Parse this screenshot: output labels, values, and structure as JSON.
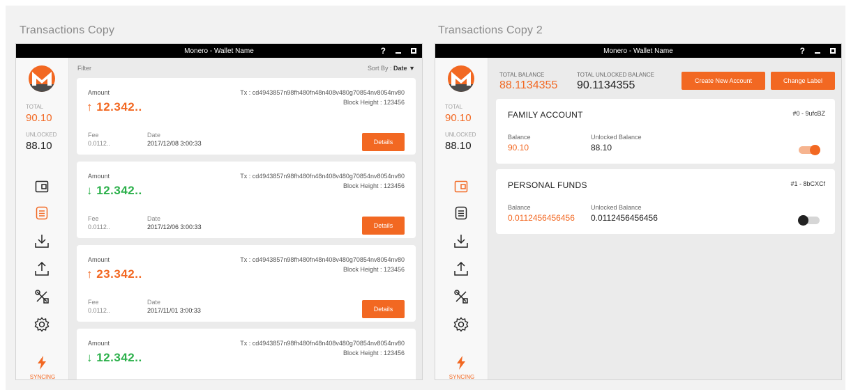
{
  "panels": [
    {
      "title": "Transactions Copy",
      "window_title": "Monero - Wallet Name",
      "help": "?",
      "sidebar": {
        "total_label": "TOTAL",
        "total_value": "90.10",
        "unlocked_label": "UNLOCKED",
        "unlocked_value": "88.10",
        "syncing": "SYNCING",
        "sync_progress": 0
      },
      "filter_label": "Filter",
      "sort_label": "Sort By :",
      "sort_value": "Date",
      "transactions": [
        {
          "amount_label": "Amount",
          "direction": "in",
          "arrow": "↑",
          "amount": "12.342..",
          "tx": "Tx : cd4943857n98fh480fn48n408v480g70854nv8054nv80",
          "block_height": "Block Height : 123456",
          "fee_label": "Fee",
          "fee": "0.0112..",
          "date_label": "Date",
          "date": "2017/12/08 3:00:33",
          "details": "Details"
        },
        {
          "amount_label": "Amount",
          "direction": "out",
          "arrow": "↓",
          "amount": "12.342..",
          "tx": "Tx : cd4943857n98fh480fn48n408v480g70854nv8054nv80",
          "block_height": "Block Height : 123456",
          "fee_label": "Fee",
          "fee": "0.0112..",
          "date_label": "Date",
          "date": "2017/12/06 3:00:33",
          "details": "Details"
        },
        {
          "amount_label": "Amount",
          "direction": "in",
          "arrow": "↑",
          "amount": "23.342..",
          "tx": "Tx : cd4943857n98fh480fn48n408v480g70854nv8054nv80",
          "block_height": "Block Height : 123456",
          "fee_label": "Fee",
          "fee": "0.0112..",
          "date_label": "Date",
          "date": "2017/11/01 3:00:33",
          "details": "Details"
        },
        {
          "amount_label": "Amount",
          "direction": "out",
          "arrow": "↓",
          "amount": "12.342..",
          "tx": "Tx : cd4943857n98fh480fn48n408v480g70854nv8054nv80",
          "block_height": "Block Height : 123456"
        }
      ]
    },
    {
      "title": "Transactions Copy 2",
      "window_title": "Monero - Wallet Name",
      "help": "?",
      "sidebar": {
        "total_label": "TOTAL",
        "total_value": "90.10",
        "unlocked_label": "UNLOCKED",
        "unlocked_value": "88.10",
        "syncing": "SYNCING",
        "sync_progress": 0
      },
      "total_balance_label": "TOTAL BALANCE",
      "total_balance": "88.1134355",
      "total_unlocked_label": "TOTAL UNLOCKED BALANCE",
      "total_unlocked": "90.1134355",
      "create_account": "Create New Account",
      "change_label": "Change Label",
      "accounts": [
        {
          "name": "FAMILY ACCOUNT",
          "id": "#0 - 9ufcBZ",
          "balance_label": "Balance",
          "balance": "90.10",
          "unlocked_label": "Unlocked Balance",
          "unlocked": "88.10",
          "enabled": true
        },
        {
          "name": "PERSONAL FUNDS",
          "id": "#1 - 8bCXCf",
          "balance_label": "Balance",
          "balance": "0.0112456456456",
          "unlocked_label": "Unlocked Balance",
          "unlocked": "0.0112456456456",
          "enabled": false
        }
      ]
    }
  ],
  "colors": {
    "accent": "#f26822",
    "incoming": "#f26822",
    "outgoing": "#2bb04a",
    "titlebar": "#000000"
  },
  "icons": [
    "monero-logo-icon",
    "wallet-icon",
    "transactions-icon",
    "receive-icon",
    "send-icon",
    "tools-icon",
    "settings-icon",
    "bolt-icon"
  ]
}
